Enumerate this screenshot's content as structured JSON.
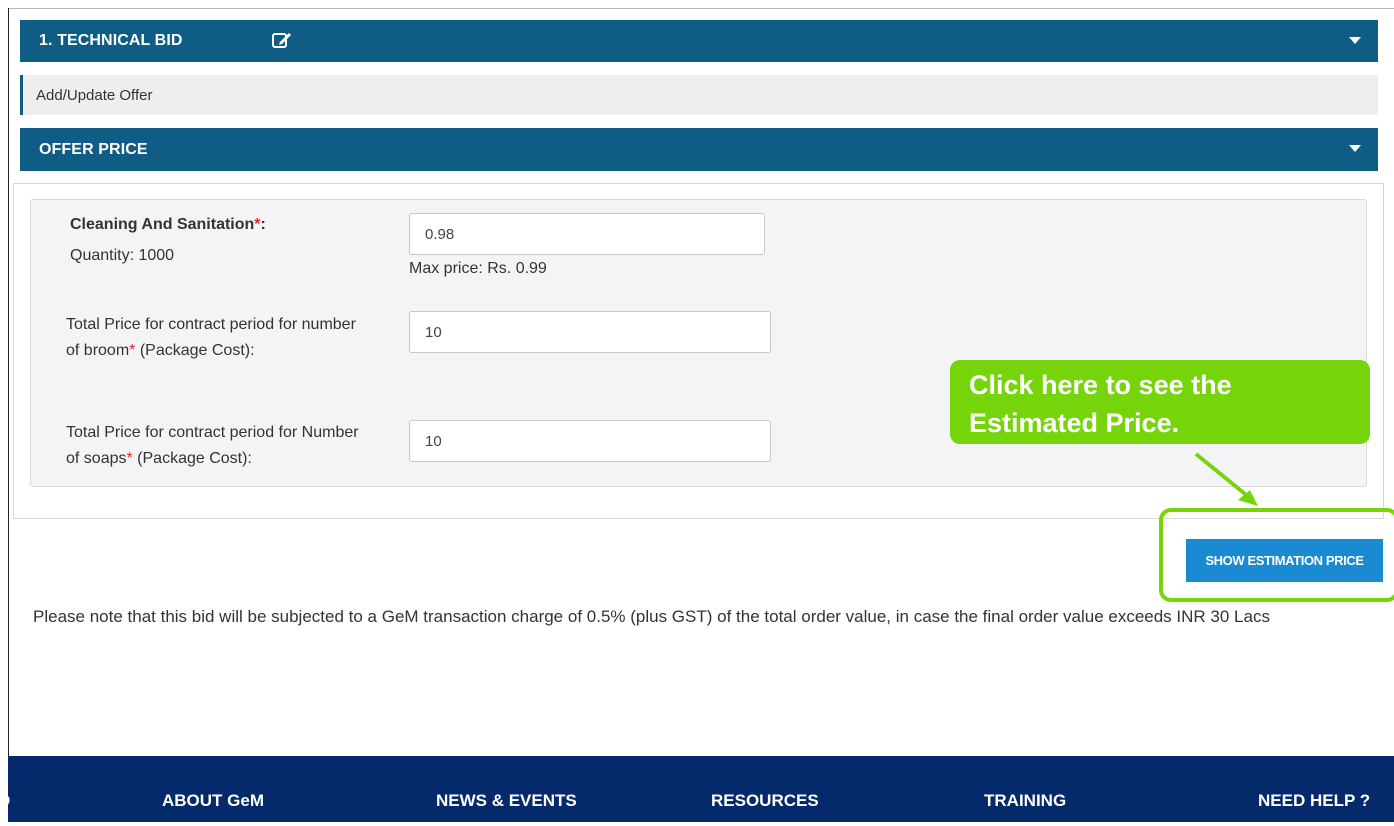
{
  "sections": {
    "technical_bid": "1. TECHNICAL BID",
    "add_update_offer": "Add/Update Offer",
    "offer_price": "OFFER PRICE"
  },
  "offer": {
    "item_label": "Cleaning And Sanitation",
    "item_required": "*",
    "item_colon": ":",
    "quantity": "Quantity: 1000",
    "price_value": "0.98",
    "max_price": "Max price: Rs. 0.99",
    "broom_label_a": "Total Price for contract period for number of broom",
    "broom_label_b": " (Package Cost):",
    "broom_required": "*",
    "broom_value": "10",
    "soaps_label_a": "Total Price for contract period for Number of soaps",
    "soaps_label_b": " (Package Cost):",
    "soaps_required": "*",
    "soaps_value": "10"
  },
  "callout": {
    "text": "Click here to see the Estimated Price."
  },
  "button": {
    "show_estimation": "SHOW ESTIMATION PRICE"
  },
  "note": "Please note that this bid will be subjected to a GeM transaction charge of 0.5% (plus GST) of the total order value, in case the final order value exceeds INR 30 Lacs",
  "footer": {
    "cut_item": "D",
    "items": [
      "ABOUT GeM",
      "NEWS & EVENTS",
      "RESOURCES",
      "TRAINING",
      "NEED HELP ?"
    ]
  },
  "colors": {
    "section_bar": "#0f5d85",
    "button": "#1a8ad2",
    "callout": "#76d40b",
    "footer": "#052a6c",
    "required": "#e0282d"
  }
}
